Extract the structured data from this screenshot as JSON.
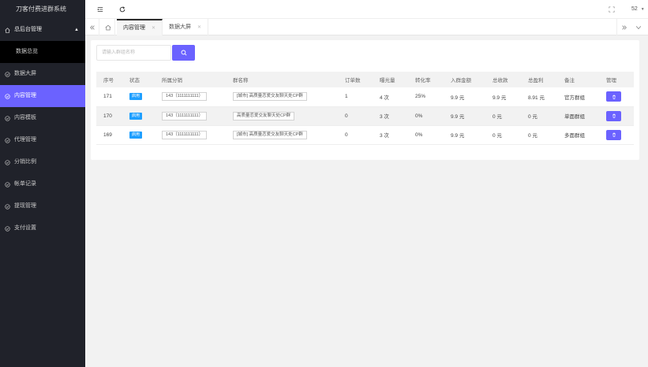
{
  "app": {
    "title": "刀客付费进群系统"
  },
  "sidebar": {
    "items": [
      {
        "label": "总后台管理",
        "icon": "home-icon",
        "expanded": true
      },
      {
        "label": "数据总览",
        "sub": true
      },
      {
        "label": "数据大屏",
        "icon": "circle-check-icon"
      },
      {
        "label": "内容管理",
        "icon": "circle-check-icon",
        "active": true
      },
      {
        "label": "内容模板",
        "icon": "circle-check-icon"
      },
      {
        "label": "代理管理",
        "icon": "circle-check-icon"
      },
      {
        "label": "分销比例",
        "icon": "circle-check-icon"
      },
      {
        "label": "帐单记录",
        "icon": "circle-check-icon"
      },
      {
        "label": "提现管理",
        "icon": "circle-check-icon"
      },
      {
        "label": "支付设置",
        "icon": "circle-check-icon"
      }
    ]
  },
  "header": {
    "menu_icon": "menu-fold-icon",
    "refresh_icon": "refresh-icon",
    "fullscreen_icon": "fullscreen-icon",
    "user_number": "52"
  },
  "tabs": {
    "items": [
      {
        "label": "内容管理",
        "active": true
      },
      {
        "label": "数据大屏",
        "active": false
      }
    ]
  },
  "search": {
    "placeholder": "请输入群组名称"
  },
  "table": {
    "headers": [
      "序号",
      "状态",
      "所属分销",
      "群名称",
      "订单数",
      "曝光量",
      "转化率",
      "入群金额",
      "总收款",
      "总盈利",
      "备注",
      "管理"
    ],
    "rows": [
      {
        "id": "171",
        "status": "启用",
        "distributor": "143（1111111111）",
        "name": "[城市] 高质量恋爱交友聊天处CP群",
        "orders": "1",
        "views": "4 次",
        "rate": "25%",
        "price": "9.9 元",
        "income": "9.9 元",
        "profit": "8.91 元",
        "note": "官方群组"
      },
      {
        "id": "170",
        "status": "启用",
        "distributor": "143（1111111111）",
        "name": "高质量恋爱交友聊天处CP群",
        "orders": "0",
        "views": "3 次",
        "rate": "0%",
        "price": "9.9 元",
        "income": "0 元",
        "profit": "0 元",
        "note": "单面群组"
      },
      {
        "id": "169",
        "status": "启用",
        "distributor": "143（1111111111）",
        "name": "[城市] 高质量恋爱交友聊天处CP群",
        "orders": "0",
        "views": "3 次",
        "rate": "0%",
        "price": "9.9 元",
        "income": "0 元",
        "profit": "0 元",
        "note": "多面群组"
      }
    ]
  },
  "colors": {
    "accent": "#6b62ff",
    "sidebar_bg": "#20222a",
    "badge": "#1e9fff"
  }
}
